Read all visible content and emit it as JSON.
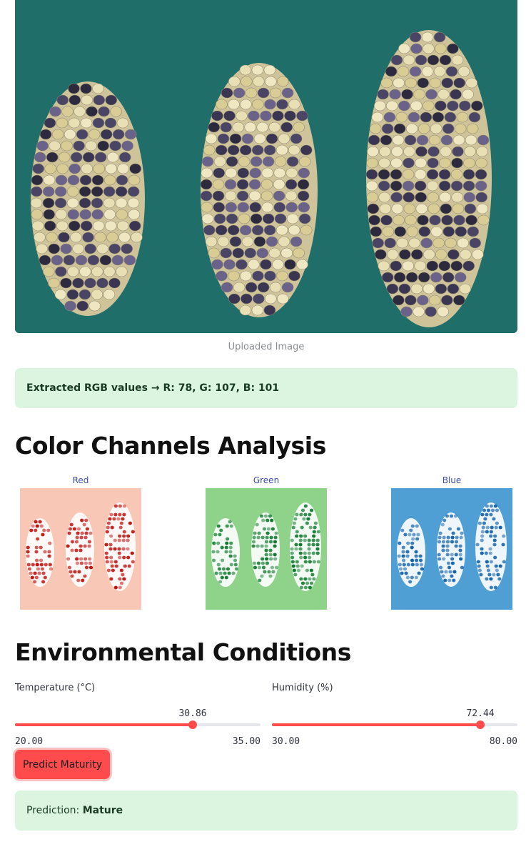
{
  "photo": {
    "caption": "Uploaded Image"
  },
  "rgb_alert": {
    "prefix": "Extracted RGB values → R: 78, G: 107, B: 101"
  },
  "color_section": {
    "title": "Color Channels Analysis",
    "channels": [
      {
        "name": "Red",
        "bg": "#f9c7b5",
        "dot": "#c1120f"
      },
      {
        "name": "Green",
        "bg": "#8fd38a",
        "dot": "#0f7a2f"
      },
      {
        "name": "Blue",
        "bg": "#4f9fd4",
        "dot": "#1060a8"
      }
    ]
  },
  "env_section": {
    "title": "Environmental Conditions"
  },
  "temperature": {
    "label": "Temperature (°C)",
    "value": "30.86",
    "min": "20.00",
    "max": "35.00",
    "fraction": 0.724
  },
  "humidity": {
    "label": "Humidity (%)",
    "value": "72.44",
    "min": "30.00",
    "max": "80.00",
    "fraction": 0.849
  },
  "button": {
    "label": "Predict Maturity"
  },
  "prediction": {
    "prefix": "Prediction: ",
    "value": "Mature"
  },
  "colors": {
    "accent": "#ff4b4b",
    "success_bg": "#dcf5e1",
    "photo_bg": "#1f6e69"
  }
}
